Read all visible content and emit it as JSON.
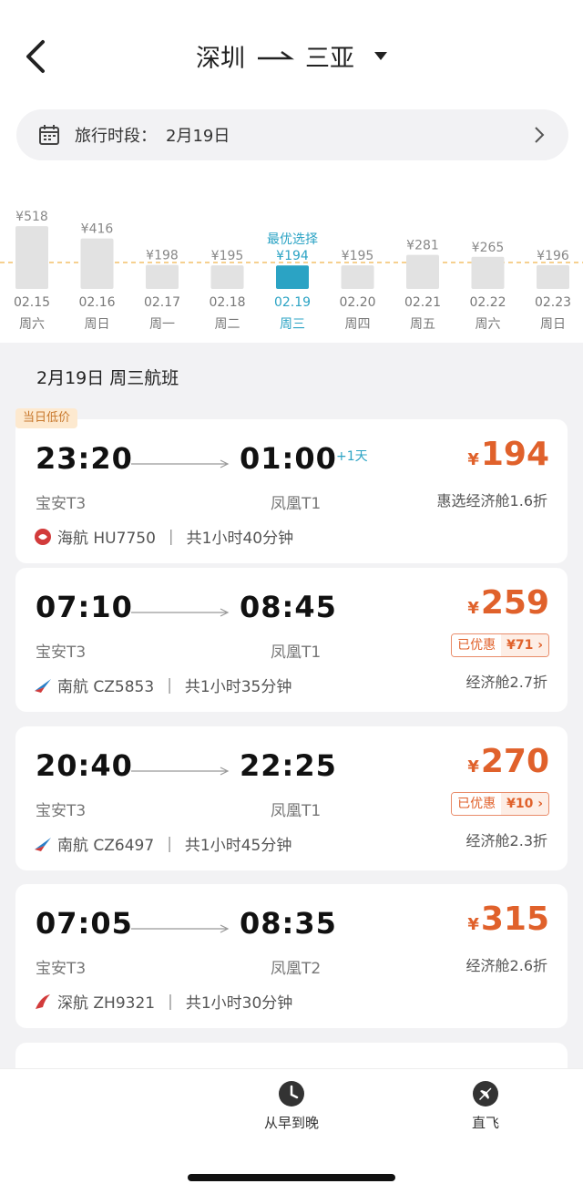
{
  "header": {
    "from": "深圳",
    "to": "三亚"
  },
  "date_bar": {
    "label": "旅行时段：",
    "date": "2月19日"
  },
  "price_calendar": {
    "best_label": "最优选择",
    "days": [
      {
        "price": "¥518",
        "date": "02.15",
        "weekday": "周六",
        "value": 518
      },
      {
        "price": "¥416",
        "date": "02.16",
        "weekday": "周日",
        "value": 416
      },
      {
        "price": "¥198",
        "date": "02.17",
        "weekday": "周一",
        "value": 198
      },
      {
        "price": "¥195",
        "date": "02.18",
        "weekday": "周二",
        "value": 195
      },
      {
        "price": "¥194",
        "date": "02.19",
        "weekday": "周三",
        "value": 194,
        "selected": true
      },
      {
        "price": "¥195",
        "date": "02.20",
        "weekday": "周四",
        "value": 195
      },
      {
        "price": "¥281",
        "date": "02.21",
        "weekday": "周五",
        "value": 281
      },
      {
        "price": "¥265",
        "date": "02.22",
        "weekday": "周六",
        "value": 265
      },
      {
        "price": "¥196",
        "date": "02.23",
        "weekday": "周日",
        "value": 196
      }
    ]
  },
  "section_title": "2月19日 周三航班",
  "flights": [
    {
      "badge": "当日低价",
      "dep_time": "23:20",
      "arr_time": "01:00",
      "plus_day": "+1天",
      "dep_airport": "宝安T3",
      "arr_airport": "凤凰T1",
      "airline": "海航 HU7750",
      "duration": "共1小时40分钟",
      "price": "194",
      "cabin": "惠选经济舱1.6折",
      "logo": "hainan-airlines-icon"
    },
    {
      "dep_time": "07:10",
      "arr_time": "08:45",
      "dep_airport": "宝安T3",
      "arr_airport": "凤凰T1",
      "airline": "南航 CZ5853",
      "duration": "共1小时35分钟",
      "price": "259",
      "discount_label": "已优惠",
      "discount_value": "¥71",
      "cabin": "经济舱2.7折",
      "logo": "china-southern-icon"
    },
    {
      "dep_time": "20:40",
      "arr_time": "22:25",
      "dep_airport": "宝安T3",
      "arr_airport": "凤凰T1",
      "airline": "南航 CZ6497",
      "duration": "共1小时45分钟",
      "price": "270",
      "discount_label": "已优惠",
      "discount_value": "¥10",
      "cabin": "经济舱2.3折",
      "logo": "china-southern-icon"
    },
    {
      "dep_time": "07:05",
      "arr_time": "08:35",
      "dep_airport": "宝安T3",
      "arr_airport": "凤凰T2",
      "airline": "深航 ZH9321",
      "duration": "共1小时30分钟",
      "price": "315",
      "cabin": "经济舱2.6折",
      "logo": "shenzhen-airlines-icon"
    }
  ],
  "bottom_tabs": [
    {
      "label": "从早到晚",
      "icon": "clock-icon"
    },
    {
      "label": "直飞",
      "icon": "plane-icon"
    }
  ],
  "currency_symbol": "¥",
  "separator": "|",
  "colors": {
    "accent": "#e0612b",
    "selected": "#2ba3c4",
    "bar": "#e2e2e2",
    "badge_bg": "#fde9cf"
  }
}
